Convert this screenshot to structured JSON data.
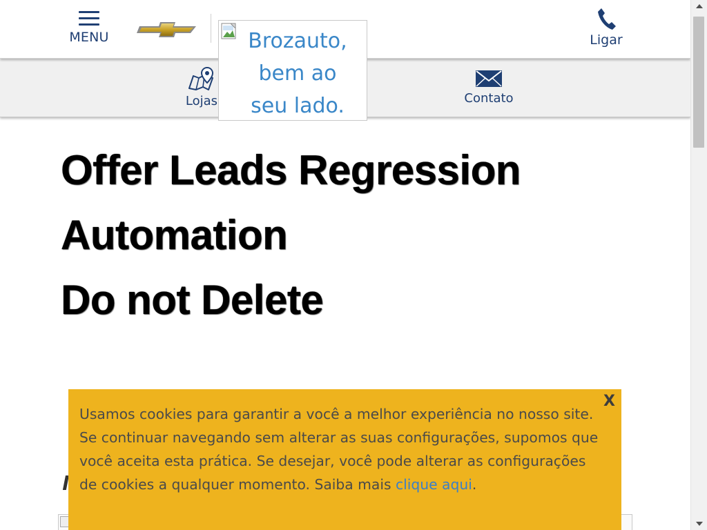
{
  "header": {
    "menu_label": "MENU",
    "menu_icon": "hamburger-icon",
    "brand_icon": "chevrolet-bowtie-icon",
    "logo_alt": "Brozauto, bem ao seu lado.",
    "logo_alt_lines": [
      "Brozauto,",
      "bem ao",
      "seu lado."
    ],
    "call_label": "Ligar",
    "call_icon": "phone-icon"
  },
  "subnav": {
    "items": [
      {
        "label": "Lojas",
        "icon": "map-pin-icon"
      },
      {
        "label": "Contato",
        "icon": "envelope-icon"
      }
    ]
  },
  "main": {
    "headline": [
      "Offer Leads Regression",
      "Automation",
      "Do not Delete"
    ],
    "partial_text": "l"
  },
  "cookie_banner": {
    "close_label": "X",
    "message": "Usamos cookies para garantir a você a melhor experiência no nosso site. Se continuar navegando sem alterar as suas configurações, supomos que você aceita esta prática. Se desejar, você pode alterar as configurações de cookies a qualquer momento. Saiba mais ",
    "link_text": "clique aqui",
    "message_end": "."
  },
  "colors": {
    "brand_blue": "#1f3f73",
    "link_blue": "#3b7fc8",
    "cookie_bg": "#eeb31e",
    "subnav_bg": "#f0f0f0",
    "bowtie_gold": "#c9a227"
  }
}
